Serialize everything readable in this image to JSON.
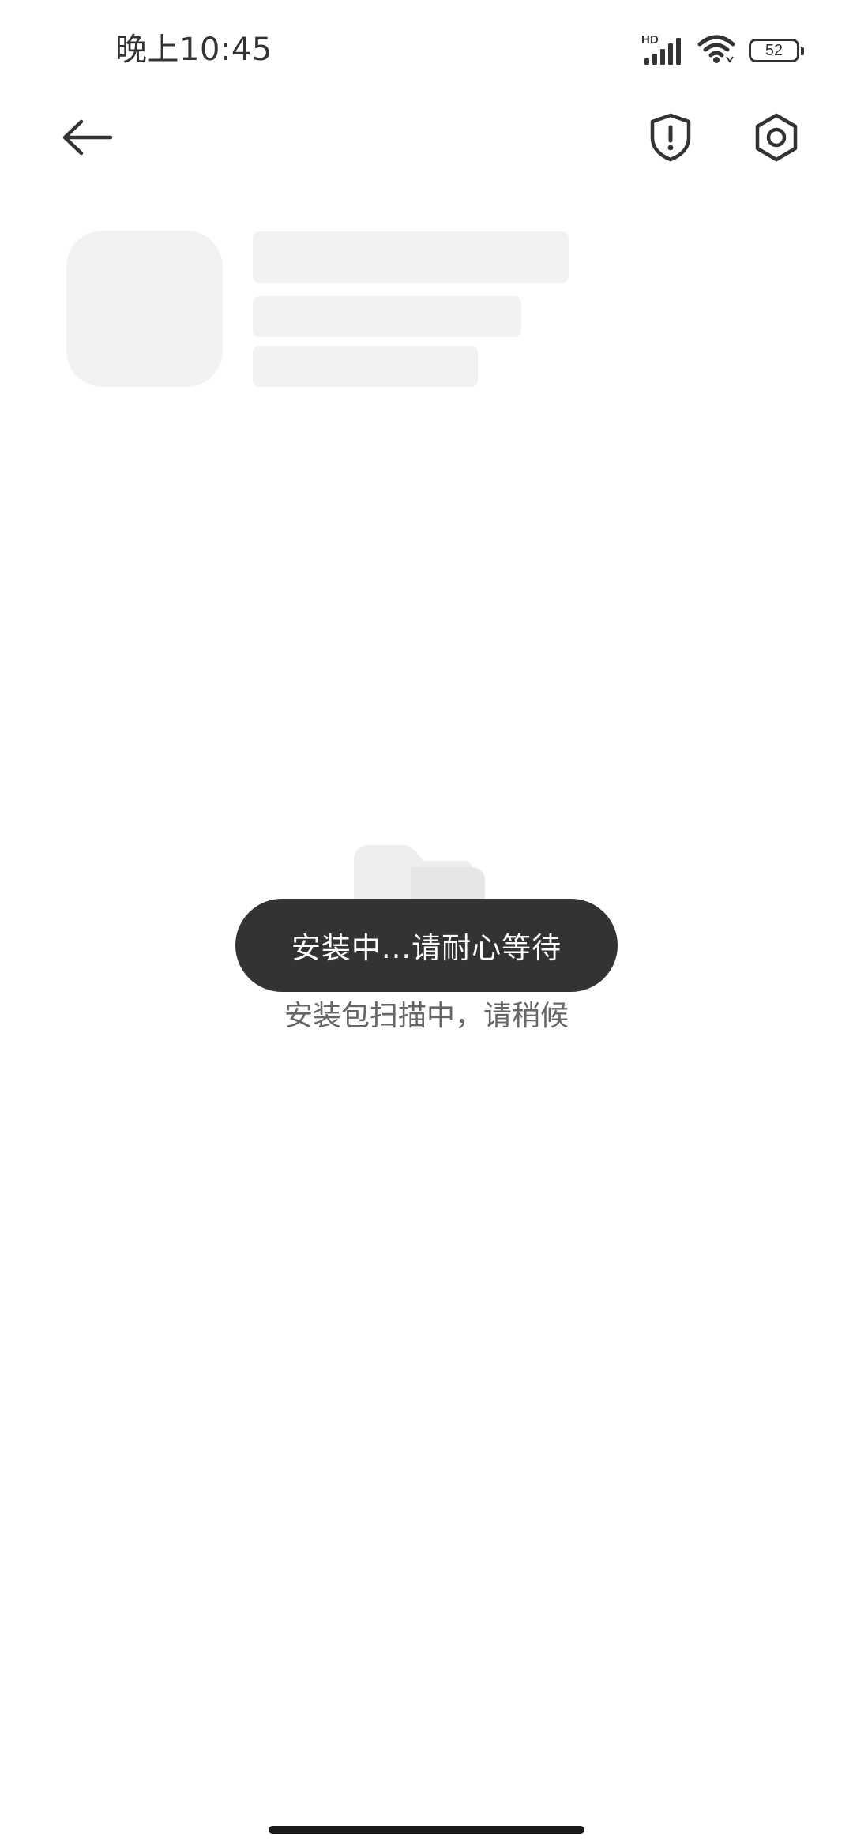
{
  "status_bar": {
    "time": "晚上10:45",
    "network_label": "HD",
    "battery": "52",
    "icons": [
      "signal-icon",
      "wifi-icon",
      "battery-icon"
    ]
  },
  "app_bar": {
    "icons": {
      "back": "back-arrow-icon",
      "security": "shield-alert-icon",
      "settings": "gear-icon"
    }
  },
  "empty_state": {
    "icon": "folder-icon",
    "message": "安装包扫描中，请稍候"
  },
  "toast": {
    "message": "安装中...请耐心等待"
  },
  "colors": {
    "skeleton": "#f2f2f2",
    "toast_bg": "#333333",
    "toast_text": "#ffffff",
    "secondary_text": "#666666"
  }
}
